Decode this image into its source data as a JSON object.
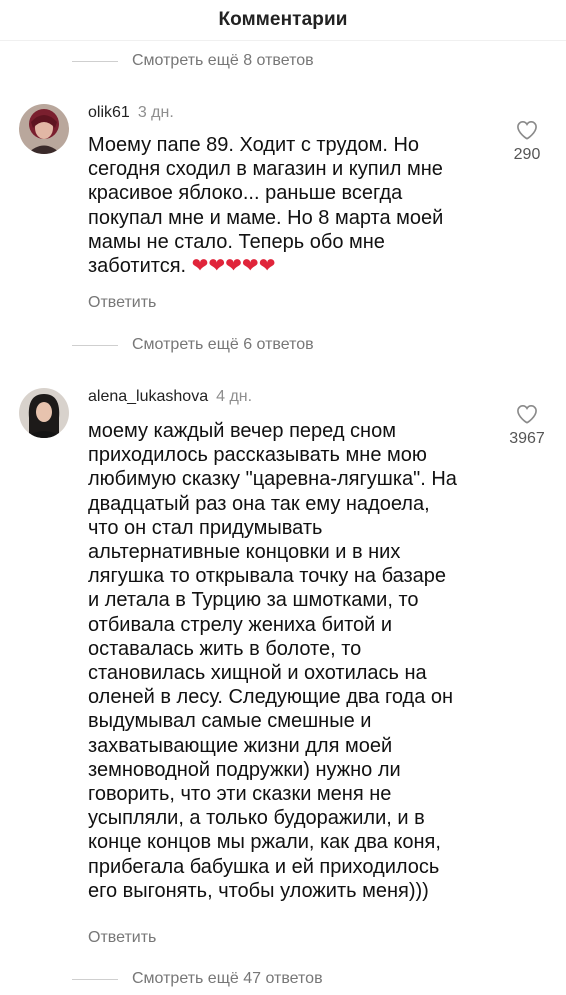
{
  "header": {
    "title": "Комментарии"
  },
  "view_more_1": "Смотреть ещё 8 ответов",
  "view_more_2": "Смотреть ещё 6 ответов",
  "view_more_3": "Смотреть ещё 47 ответов",
  "comments": [
    {
      "username": "olik61",
      "time": "3 дн.",
      "text": "Моему папе 89. Ходит с трудом. Но\nсегодня сходил в магазин и купил мне\nкрасивое яблоко... раньше всегда\nпокупал мне и маме. Но 8 марта моей\nмамы не стало.  Теперь обо мне\nзаботится.",
      "emoji": "❤❤❤❤❤",
      "likes": "290",
      "reply_label": "Ответить"
    },
    {
      "username": "alena_lukashova",
      "time": "4 дн.",
      "text": "моему каждый вечер перед сном\nприходилось рассказывать мне мою\nлюбимую сказку \"царевна-лягушка\". На\nдвадцатый раз она так ему надоела,\nчто он стал придумывать\nальтернативные концовки и в них\nлягушка то открывала точку на базаре\nи летала в Турцию за шмотками, то\nотбивала стрелу жениха битой и\nоставалась жить в болоте, то\nстановилась хищной и охотилась на\nоленей в лесу. Следующие два года он\nвыдумывал самые смешные и\nзахватывающие жизни для моей\nземноводной подружки) нужно ли\nговорить, что эти сказки меня не\nусыпляли, а только будоражили, и в\nконце концов мы ржали, как два коня,\nприбегала бабушка и ей приходилось\nего выгонять, чтобы уложить меня)))",
      "likes": "3967",
      "reply_label": "Ответить"
    }
  ],
  "colors": {
    "heart_emoji": "#e0243a",
    "secondary_text": "#777777"
  }
}
